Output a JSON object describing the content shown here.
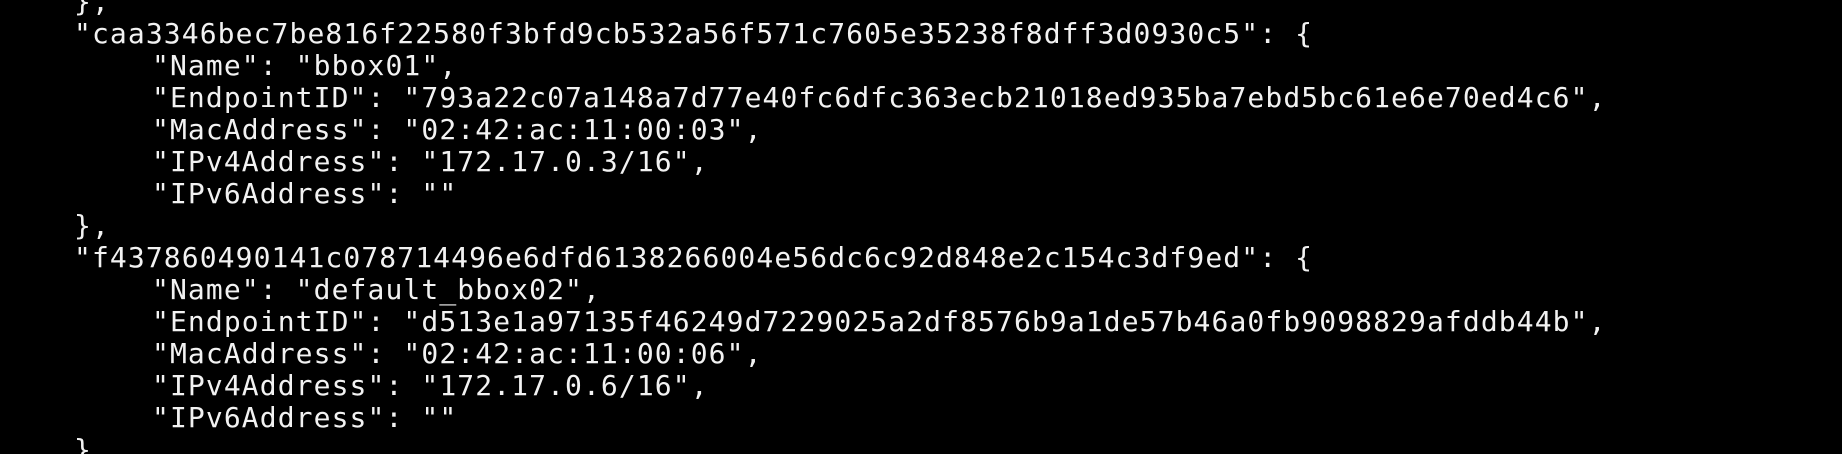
{
  "terminal": {
    "background": "#000000",
    "foreground": "#f2f2f2",
    "lines": [
      "},",
      "\"caa3346bec7be816f22580f3bfd9cb532a56f571c7605e35238f8dff3d0930c5\": {",
      "\"Name\": \"bbox01\",",
      "\"EndpointID\": \"793a22c07a148a7d77e40fc6dfc363ecb21018ed935ba7ebd5bc61e6e70ed4c6\",",
      "\"MacAddress\": \"02:42:ac:11:00:03\",",
      "\"IPv4Address\": \"172.17.0.3/16\",",
      "\"IPv6Address\": \"\"",
      "},",
      "\"f437860490141c078714496e6dfd6138266004e56dc6c92d848e2c154c3df9ed\": {",
      "\"Name\": \"default_bbox02\",",
      "\"EndpointID\": \"d513e1a97135f46249d7229025a2df8576b9a1de57b46a0fb9098829afddb44b\",",
      "\"MacAddress\": \"02:42:ac:11:00:06\",",
      "\"IPv4Address\": \"172.17.0.6/16\",",
      "\"IPv6Address\": \"\"",
      "}"
    ]
  }
}
